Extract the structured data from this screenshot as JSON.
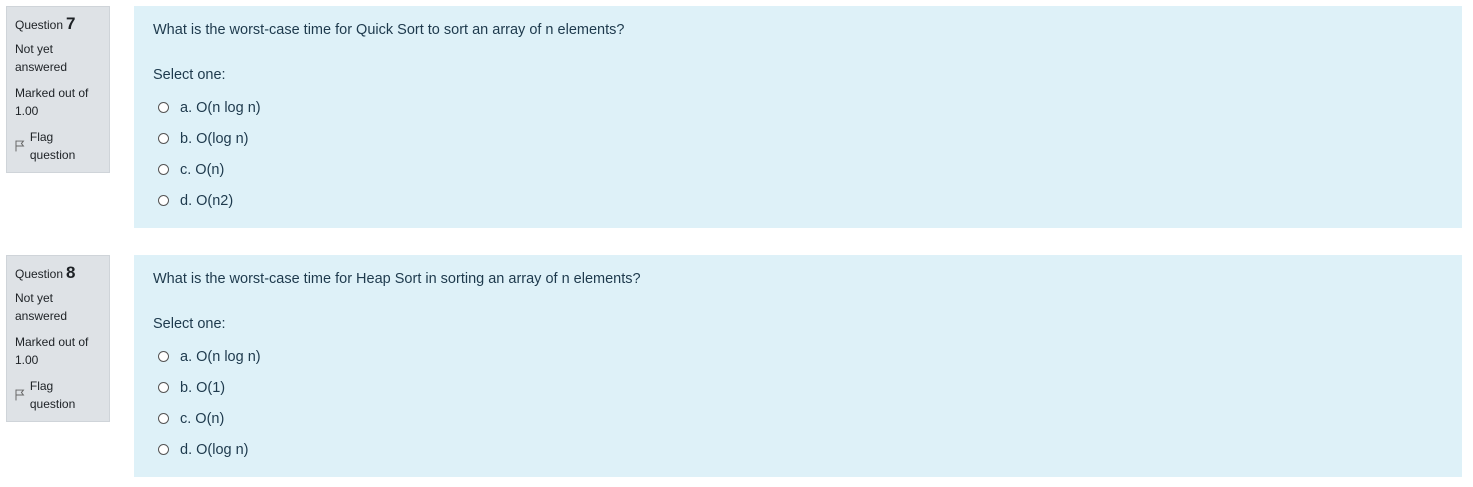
{
  "questions": [
    {
      "label": "Question",
      "number": "7",
      "state": "Not yet answered",
      "grade": "Marked out of 1.00",
      "flag": "Flag question",
      "text": "What is the worst-case time for Quick Sort to sort an array of n elements?",
      "prompt": "Select one:",
      "options": [
        "a. O(n log n)",
        "b. O(log n)",
        "c. O(n)",
        "d. O(n2)"
      ]
    },
    {
      "label": "Question",
      "number": "8",
      "state": "Not yet answered",
      "grade": "Marked out of 1.00",
      "flag": "Flag question",
      "text": "What is the worst-case time for Heap Sort in sorting an array of n elements?",
      "prompt": "Select one:",
      "options": [
        "a. O(n log n)",
        "b. O(1)",
        "c. O(n)",
        "d. O(log n)"
      ]
    }
  ]
}
